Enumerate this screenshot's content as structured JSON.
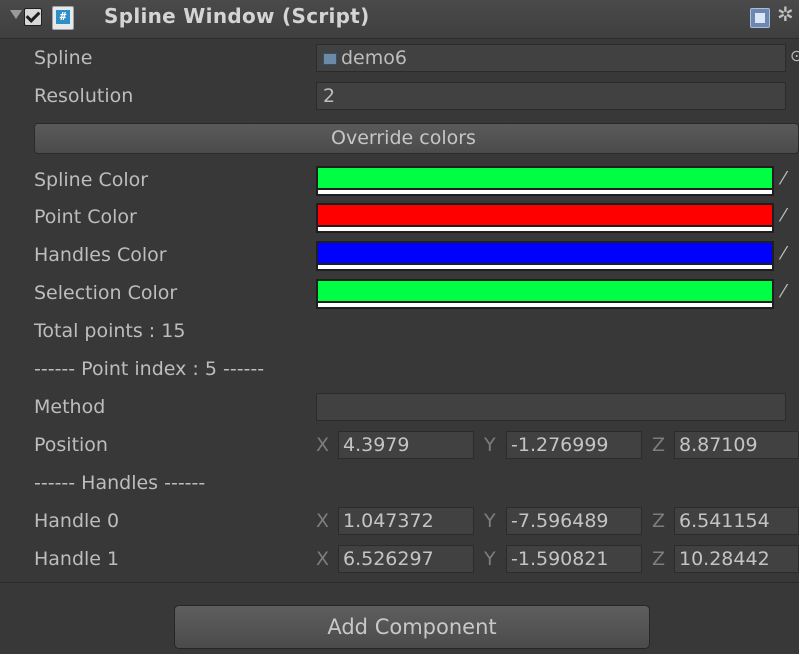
{
  "header": {
    "title": "Spline Window (Script)",
    "icons": [
      "fold-arrow",
      "checkbox-checked",
      "script-icon",
      "help-icon",
      "gear-icon"
    ]
  },
  "spline": {
    "label": "Spline",
    "value": "demo6"
  },
  "resolution": {
    "label": "Resolution",
    "value": "2"
  },
  "override_button": "Override colors",
  "colors": [
    {
      "label": "Spline Color",
      "color": "#00ff44"
    },
    {
      "label": "Point Color",
      "color": "#ff0000"
    },
    {
      "label": "Handles Color",
      "color": "#0000ff"
    },
    {
      "label": "Selection Color",
      "color": "#00ff44"
    }
  ],
  "total_points": "Total points : 15",
  "point_index": "------ Point index : 5 ------",
  "method": {
    "label": "Method",
    "value": ""
  },
  "position": {
    "label": "Position",
    "x": "4.3979",
    "y": "-1.276999",
    "z": "8.87109"
  },
  "handles_header": "------ Handles ------",
  "handles": [
    {
      "label": "Handle 0",
      "x": "1.047372",
      "y": "-7.596489",
      "z": "6.541154"
    },
    {
      "label": "Handle 1",
      "x": "6.526297",
      "y": "-1.590821",
      "z": "10.28442"
    }
  ],
  "axis_labels": {
    "x": "X",
    "y": "Y",
    "z": "Z"
  },
  "add_component": "Add Component"
}
